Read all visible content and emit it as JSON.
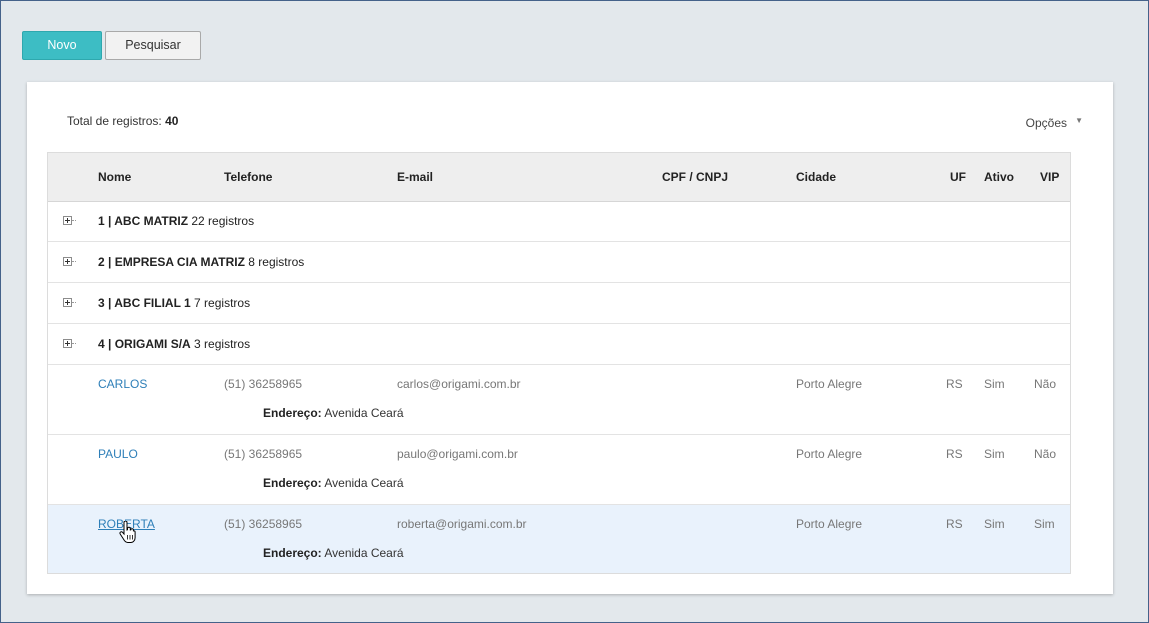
{
  "toolbar": {
    "novo_label": "Novo",
    "pesquisar_label": "Pesquisar"
  },
  "summary": {
    "total_label": "Total de registros:",
    "total_value": "40",
    "options_label": "Opções"
  },
  "columns": [
    "Nome",
    "Telefone",
    "E-mail",
    "CPF / CNPJ",
    "Cidade",
    "UF",
    "Ativo",
    "VIP"
  ],
  "groups": [
    {
      "title": "1 | ABC MATRIZ",
      "count": "22 registros"
    },
    {
      "title": "2 | EMPRESA CIA MATRIZ",
      "count": "8 registros"
    },
    {
      "title": "3 | ABC FILIAL 1",
      "count": "7 registros"
    },
    {
      "title": "4 | ORIGAMI S/A",
      "count": "3 registros"
    }
  ],
  "address_label": "Endereço:",
  "rows": [
    {
      "nome": "CARLOS",
      "telefone": "(51) 36258965",
      "email": "carlos@origami.com.br",
      "cpf": "",
      "cidade": "Porto Alegre",
      "uf": "RS",
      "ativo": "Sim",
      "vip": "Não",
      "endereco": "Avenida Ceará"
    },
    {
      "nome": "PAULO",
      "telefone": "(51) 36258965",
      "email": "paulo@origami.com.br",
      "cpf": "",
      "cidade": "Porto Alegre",
      "uf": "RS",
      "ativo": "Sim",
      "vip": "Não",
      "endereco": "Avenida Ceará"
    },
    {
      "nome": "ROBERTA",
      "telefone": "(51) 36258965",
      "email": "roberta@origami.com.br",
      "cpf": "",
      "cidade": "Porto Alegre",
      "uf": "RS",
      "ativo": "Sim",
      "vip": "Sim",
      "endereco": "Avenida Ceará"
    }
  ],
  "colors": {
    "primary": "#3dbdc4",
    "link": "#2e7fb8",
    "selected_row": "#e9f2fc"
  },
  "icons": [
    "expand-plus-icon",
    "dropdown-caret-icon",
    "hand-pointer-cursor"
  ]
}
